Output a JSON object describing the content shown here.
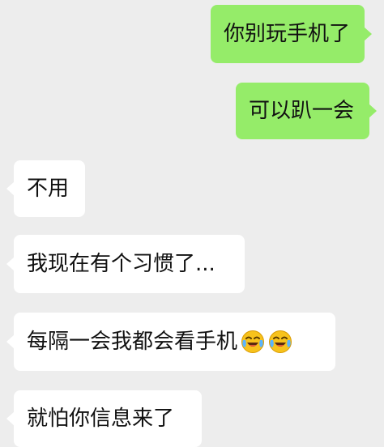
{
  "messages": [
    {
      "id": "m1",
      "direction": "outgoing",
      "text": "你别玩手机了"
    },
    {
      "id": "m2",
      "direction": "outgoing",
      "text": "可以趴一会"
    },
    {
      "id": "m3",
      "direction": "incoming",
      "text": "不用"
    },
    {
      "id": "m4",
      "direction": "incoming",
      "text": "我现在有个习惯了..."
    },
    {
      "id": "m5",
      "direction": "incoming",
      "text": "每隔一会我都会看手机",
      "emojis": [
        "laugh-cry-icon",
        "laugh-cry-icon"
      ]
    },
    {
      "id": "m6",
      "direction": "incoming",
      "text": "就怕你信息来了"
    }
  ],
  "colors": {
    "background": "#ededed",
    "outgoing_bubble": "#95ec69",
    "incoming_bubble": "#ffffff",
    "text": "#111111"
  }
}
